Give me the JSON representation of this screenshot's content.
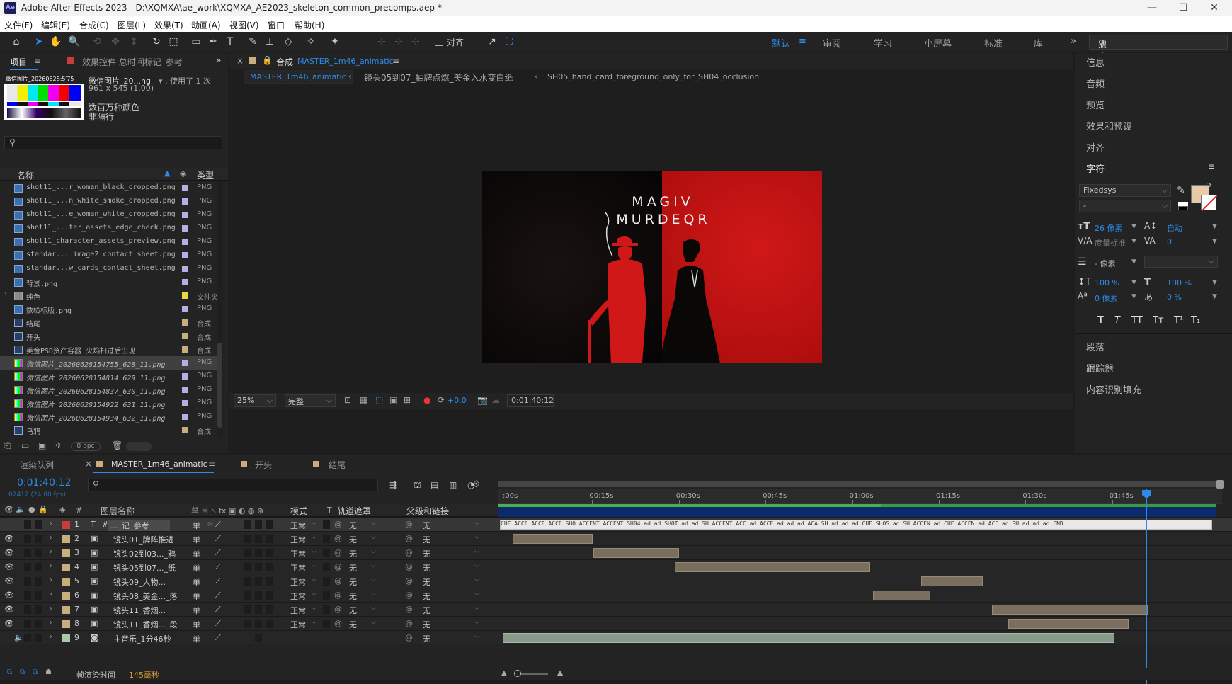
{
  "window": {
    "title": "Adobe After Effects 2023 - D:\\XQMXA\\ae_work\\XQMXA_AE2023_skeleton_common_precomps.aep *",
    "logo": "Ae",
    "minimize": "—",
    "maximize": "☐",
    "close": "✕"
  },
  "menu": [
    "文件(F)",
    "编辑(E)",
    "合成(C)",
    "图层(L)",
    "效果(T)",
    "动画(A)",
    "视图(V)",
    "窗口",
    "帮助(H)"
  ],
  "toolbar": {
    "align_label": "对齐",
    "workspaces": [
      "默认",
      "审阅",
      "学习",
      "小屏幕",
      "标准",
      "库"
    ],
    "active_workspace": "默认",
    "more": "»",
    "search_placeholder": "搜索帮助"
  },
  "project_panel": {
    "tab_project": "项目",
    "tab_effects": "效果控件 总时间标记_参考",
    "expand": "»",
    "preview_label": "微信图片_20260628:5′75",
    "item_name": "微信图片_20...ng",
    "usage": "▾ , 使用了 1 次",
    "dimensions": "961 x 545 (1.00)",
    "color_depth": "数百万种颜色",
    "interlace": "非隔行",
    "col_name": "名称",
    "col_type": "类型",
    "bpc": "8 bpc",
    "items": [
      {
        "name": "shot11_...r_woman_black_cropped.png",
        "type": "PNG",
        "color": "#b4b0e6",
        "icon": "image"
      },
      {
        "name": "shot11_...n_white_smoke_cropped.png",
        "type": "PNG",
        "color": "#b4b0e6",
        "icon": "image"
      },
      {
        "name": "shot11_...e_woman_white_cropped.png",
        "type": "PNG",
        "color": "#b4b0e6",
        "icon": "image"
      },
      {
        "name": "shot11_...ter_assets_edge_check.png",
        "type": "PNG",
        "color": "#b4b0e6",
        "icon": "image"
      },
      {
        "name": "shot11_character_assets_preview.png",
        "type": "PNG",
        "color": "#b4b0e6",
        "icon": "image"
      },
      {
        "name": "standar..._image2_contact_sheet.png",
        "type": "PNG",
        "color": "#b4b0e6",
        "icon": "image"
      },
      {
        "name": "standar...w_cards_contact_sheet.png",
        "type": "PNG",
        "color": "#b4b0e6",
        "icon": "image"
      },
      {
        "name": "背景.png",
        "type": "PNG",
        "color": "#b4b0e6",
        "icon": "image"
      },
      {
        "name": "纯色",
        "type": "文件夹",
        "color": "#e6d84a",
        "icon": "folder"
      },
      {
        "name": "数检标版.png",
        "type": "PNG",
        "color": "#b4b0e6",
        "icon": "image"
      },
      {
        "name": "结尾",
        "type": "合成",
        "color": "#c8ad7e",
        "icon": "comp"
      },
      {
        "name": "开头",
        "type": "合成",
        "color": "#c8ad7e",
        "icon": "comp"
      },
      {
        "name": "美金PSD资产容器_火焰扫过后出现",
        "type": "合成",
        "color": "#c8ad7e",
        "icon": "comp"
      },
      {
        "name": "微信图片_20260628154755_628_11.png",
        "type": "PNG",
        "color": "#b4b0e6",
        "icon": "bars",
        "selected": true
      },
      {
        "name": "微信图片_20260628154814_629_11.png",
        "type": "PNG",
        "color": "#b4b0e6",
        "icon": "bars"
      },
      {
        "name": "微信图片_20260628154837_630_11.png",
        "type": "PNG",
        "color": "#b4b0e6",
        "icon": "bars"
      },
      {
        "name": "微信图片_20260628154922_631_11.png",
        "type": "PNG",
        "color": "#b4b0e6",
        "icon": "bars"
      },
      {
        "name": "微信图片_20260628154934_632_11.png",
        "type": "PNG",
        "color": "#b4b0e6",
        "icon": "bars"
      },
      {
        "name": "乌鸦",
        "type": "合成",
        "color": "#c8ad7e",
        "icon": "comp"
      }
    ]
  },
  "composition_panel": {
    "tab_prefix": "合成",
    "tab_name": "MASTER_1m46_animatic",
    "breadcrumbs": [
      "MASTER_1m46_animatic",
      "镜头05到07_抽牌点燃_美金入水变白纸",
      "SH05_hand_card_foreground_only_for_SH04_occlusion"
    ],
    "poster_title_line1": "MAGIV",
    "poster_title_line2": "MURDEQR",
    "zoom": "25%",
    "resolution": "完整",
    "exposure": "+0.0",
    "timecode": "0:01:40:12"
  },
  "right_panel": {
    "items": [
      "信息",
      "音频",
      "预览",
      "效果和预设",
      "对齐",
      "字符"
    ],
    "font_family": "Fixedsys",
    "font_style": "-",
    "font_size": "26 像素",
    "leading": "自动",
    "kerning": "度量标准",
    "tracking": "0",
    "stroke_width": "- 像素",
    "vertical_scale": "100 %",
    "horizontal_scale": "100 %",
    "baseline_shift": "0 像素",
    "tsume": "0 %",
    "style_buttons": [
      "T",
      "T",
      "TT",
      "Tт",
      "T¹",
      "T₁"
    ],
    "lower_items": [
      "段落",
      "跟踪器",
      "内容识别填充"
    ]
  },
  "timeline": {
    "tab_render": "渲染队列",
    "tab_master": "MASTER_1m46_animatic",
    "tab_open": "开头",
    "tab_end": "结尾",
    "timecode": "0:01:40:12",
    "frames": "02412 (24.00 fps)",
    "ruler_labels": [
      ":00s",
      "00:15s",
      "00:30s",
      "00:45s",
      "01:00s",
      "01:15s",
      "01:30s",
      "01:45s"
    ],
    "header_name": "图层名称",
    "header_mode": "模式",
    "header_t": "T",
    "header_track": "轨道遮罩",
    "header_parent": "父级和链接",
    "marker_strip": "CUE ACCE ACCE ACCE SHO ACCENT ACCENT SH04 ad ad SHOT ad ad SH ACCENT ACC ad ACCE ad ad ad ACA SH ad ad ad CUE SHOS ad SH ACCEN ad CUE ACCEN ad ACC ad SH ad ad ad END",
    "layers": [
      {
        "num": "1",
        "name": "..._记_参考",
        "color": "#c83c3c",
        "mode": "正常",
        "track": "无",
        "parent": "无",
        "kind": "text"
      },
      {
        "num": "2",
        "name": "镜头01_牌阵推进",
        "color": "#c8ad7e",
        "mode": "正常",
        "track": "无",
        "parent": "无",
        "kind": "comp"
      },
      {
        "num": "3",
        "name": "镜头02到03..._鸦",
        "color": "#c8ad7e",
        "mode": "正常",
        "track": "无",
        "parent": "无",
        "kind": "comp"
      },
      {
        "num": "4",
        "name": "镜头05到07..._纸",
        "color": "#c8ad7e",
        "mode": "正常",
        "track": "无",
        "parent": "无",
        "kind": "comp"
      },
      {
        "num": "5",
        "name": "镜头09_人物...",
        "color": "#c8ad7e",
        "mode": "正常",
        "track": "无",
        "parent": "无",
        "kind": "comp"
      },
      {
        "num": "6",
        "name": "镜头08_美金..._落",
        "color": "#c8ad7e",
        "mode": "正常",
        "track": "无",
        "parent": "无",
        "kind": "comp"
      },
      {
        "num": "7",
        "name": "镜头11_香烟...",
        "color": "#c8ad7e",
        "mode": "正常",
        "track": "无",
        "parent": "无",
        "kind": "comp"
      },
      {
        "num": "8",
        "name": "镜头11_香烟..._段",
        "color": "#c8ad7e",
        "mode": "正常",
        "track": "无",
        "parent": "无",
        "kind": "comp"
      },
      {
        "num": "9",
        "name": "主音乐_1分46秒",
        "color": "#a8c8a8",
        "mode": "",
        "track": "",
        "parent": "无",
        "kind": "audio"
      }
    ],
    "render_time_label": "帧渲染时间",
    "render_time_value": "145毫秒"
  }
}
